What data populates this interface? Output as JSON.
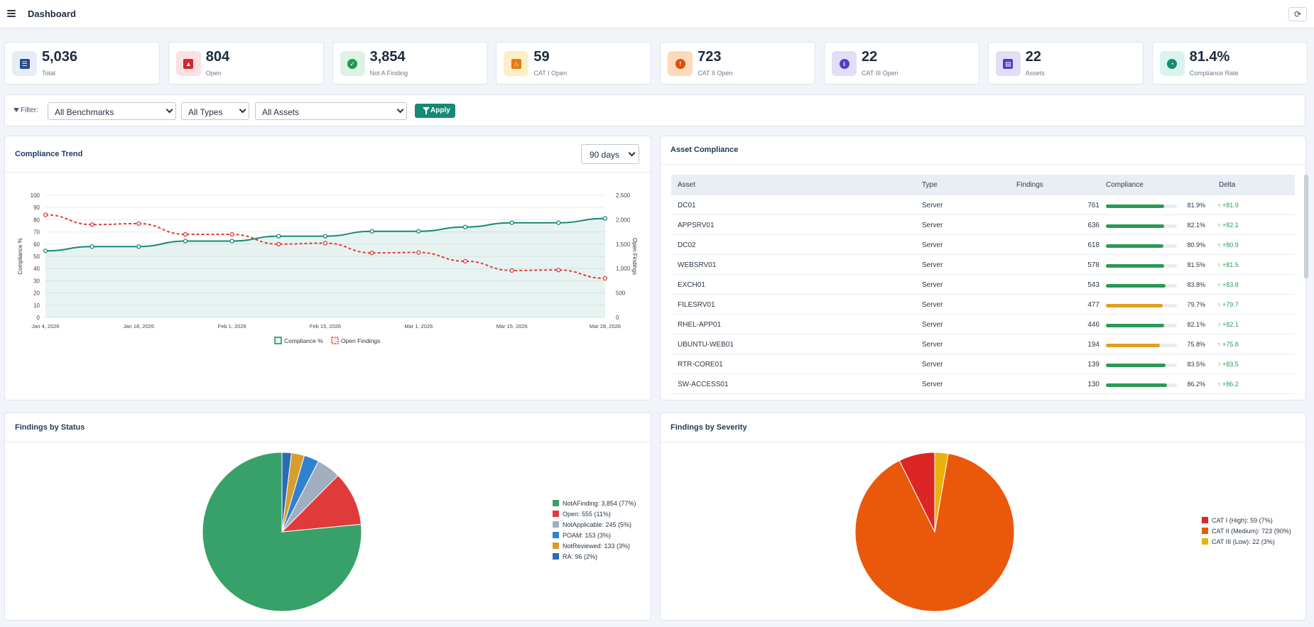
{
  "header": {
    "title": "Dashboard",
    "menu_icon": "hamburger-icon",
    "refresh_icon": "refresh-icon"
  },
  "stats": [
    {
      "value": "5,036",
      "label": "Total",
      "icon": "list-icon",
      "icon_color": "#2a4a8a",
      "bg": "#e6edf8"
    },
    {
      "value": "804",
      "label": "Open",
      "icon": "warning-icon",
      "icon_color": "#d3262e",
      "bg": "#fbe1e1"
    },
    {
      "value": "3,854",
      "label": "Not A Finding",
      "icon": "check-circle-icon",
      "icon_color": "#1f9a4e",
      "bg": "#def3e5"
    },
    {
      "value": "59",
      "label": "CAT I Open",
      "icon": "fire-icon",
      "icon_color": "#e07c12",
      "bg": "#fdefc6"
    },
    {
      "value": "723",
      "label": "CAT II Open",
      "icon": "exclamation-circle-icon",
      "icon_color": "#e04a0a",
      "bg": "#fcd9b8"
    },
    {
      "value": "22",
      "label": "CAT III Open",
      "icon": "info-circle-icon",
      "icon_color": "#4d3fc7",
      "bg": "#e2def7"
    },
    {
      "value": "22",
      "label": "Assets",
      "icon": "server-icon",
      "icon_color": "#4d3fc7",
      "bg": "#e2def7"
    },
    {
      "value": "81.4%",
      "label": "Compliance Rate",
      "icon": "pie-chart-icon",
      "icon_color": "#168a74",
      "bg": "#daf3ee"
    }
  ],
  "filter": {
    "label": "Filter:",
    "benchmarks": "All Benchmarks",
    "types": "All Types",
    "assets": "All Assets",
    "apply": "Apply"
  },
  "trend": {
    "title": "Compliance Trend",
    "range": "90 days"
  },
  "asset_compliance": {
    "title": "Asset Compliance",
    "columns": [
      "Asset",
      "Type",
      "Findings",
      "Compliance",
      "Delta"
    ],
    "rows": [
      {
        "asset": "DC01",
        "type": "Server",
        "findings": "761",
        "compliance": 81.9,
        "compliance_text": "81.9%",
        "delta": "+81.9",
        "color": "#2a9a55"
      },
      {
        "asset": "APPSRV01",
        "type": "Server",
        "findings": "636",
        "compliance": 82.1,
        "compliance_text": "82.1%",
        "delta": "+82.1",
        "color": "#2a9a55"
      },
      {
        "asset": "DC02",
        "type": "Server",
        "findings": "618",
        "compliance": 80.9,
        "compliance_text": "80.9%",
        "delta": "+80.9",
        "color": "#2a9a55"
      },
      {
        "asset": "WEBSRV01",
        "type": "Server",
        "findings": "578",
        "compliance": 81.5,
        "compliance_text": "81.5%",
        "delta": "+81.5",
        "color": "#2a9a55"
      },
      {
        "asset": "EXCH01",
        "type": "Server",
        "findings": "543",
        "compliance": 83.8,
        "compliance_text": "83.8%",
        "delta": "+83.8",
        "color": "#2a9a55"
      },
      {
        "asset": "FILESRV01",
        "type": "Server",
        "findings": "477",
        "compliance": 79.7,
        "compliance_text": "79.7%",
        "delta": "+79.7",
        "color": "#e0a020"
      },
      {
        "asset": "RHEL-APP01",
        "type": "Server",
        "findings": "446",
        "compliance": 82.1,
        "compliance_text": "82.1%",
        "delta": "+82.1",
        "color": "#2a9a55"
      },
      {
        "asset": "UBUNTU-WEB01",
        "type": "Server",
        "findings": "194",
        "compliance": 75.8,
        "compliance_text": "75.8%",
        "delta": "+75.8",
        "color": "#e0a020"
      },
      {
        "asset": "RTR-CORE01",
        "type": "Server",
        "findings": "139",
        "compliance": 83.5,
        "compliance_text": "83.5%",
        "delta": "+83.5",
        "color": "#2a9a55"
      },
      {
        "asset": "SW-ACCESS01",
        "type": "Server",
        "findings": "130",
        "compliance": 86.2,
        "compliance_text": "86.2%",
        "delta": "+86.2",
        "color": "#2a9a55"
      }
    ]
  },
  "status_panel": {
    "title": "Findings by Status"
  },
  "severity_panel": {
    "title": "Findings by Severity"
  },
  "chart_data": [
    {
      "type": "line",
      "x": [
        "Jan 4, 2026",
        "Jan 11, 2026",
        "Jan 18, 2026",
        "Jan 25, 2026",
        "Feb 1, 2026",
        "Feb 8, 2026",
        "Feb 15, 2026",
        "Feb 22, 2026",
        "Mar 1, 2026",
        "Mar 8, 2026",
        "Mar 15, 2026",
        "Mar 22, 2026",
        "Mar 28, 2026"
      ],
      "x_tick_labels": [
        "Jan 4, 2026",
        "Jan 18, 2026",
        "Feb 1, 2026",
        "Feb 15, 2026",
        "Mar 1, 2026",
        "Mar 15, 2026",
        "Mar 28, 2026"
      ],
      "series": [
        {
          "name": "Compliance %",
          "axis": "left",
          "color": "#168a74",
          "values": [
            54.5,
            58,
            58,
            62.5,
            62.5,
            66.5,
            66.5,
            70.5,
            70.5,
            74,
            77.5,
            77.5,
            81
          ]
        },
        {
          "name": "Open Findings",
          "axis": "right",
          "color": "#e03b3b",
          "values": [
            2100,
            1900,
            1920,
            1700,
            1700,
            1500,
            1520,
            1320,
            1330,
            1150,
            960,
            970,
            800
          ]
        }
      ],
      "ylabel": "Compliance %",
      "ylim": [
        0,
        100
      ],
      "y_ticks": [
        0,
        10,
        20,
        30,
        40,
        50,
        60,
        70,
        80,
        90,
        100
      ],
      "y2label": "Open Findings",
      "y2lim": [
        0,
        2500
      ],
      "y2_ticks": [
        "0",
        "500",
        "1,000",
        "1,500",
        "2,000",
        "2,500"
      ],
      "legend": "bottom",
      "grid": true
    },
    {
      "type": "pie",
      "labels": [
        "NotAFinding: 3,854 (77%)",
        "Open: 555 (11%)",
        "NotApplicable: 245 (5%)",
        "POAM: 153 (3%)",
        "NotReviewed: 133 (3%)",
        "RA: 96 (2%)"
      ],
      "values": [
        3854,
        555,
        245,
        153,
        133,
        96
      ],
      "colors": [
        "#38a169",
        "#e03b3b",
        "#a0aec0",
        "#3182ce",
        "#d69e2e",
        "#2b6cb0"
      ],
      "legend": "right"
    },
    {
      "type": "pie",
      "labels": [
        "CAT I (High): 59 (7%)",
        "CAT II (Medium): 723 (90%)",
        "CAT III (Low): 22 (3%)"
      ],
      "values": [
        59,
        723,
        22
      ],
      "colors": [
        "#dc2626",
        "#ea580c",
        "#eab308"
      ],
      "legend": "right"
    }
  ]
}
